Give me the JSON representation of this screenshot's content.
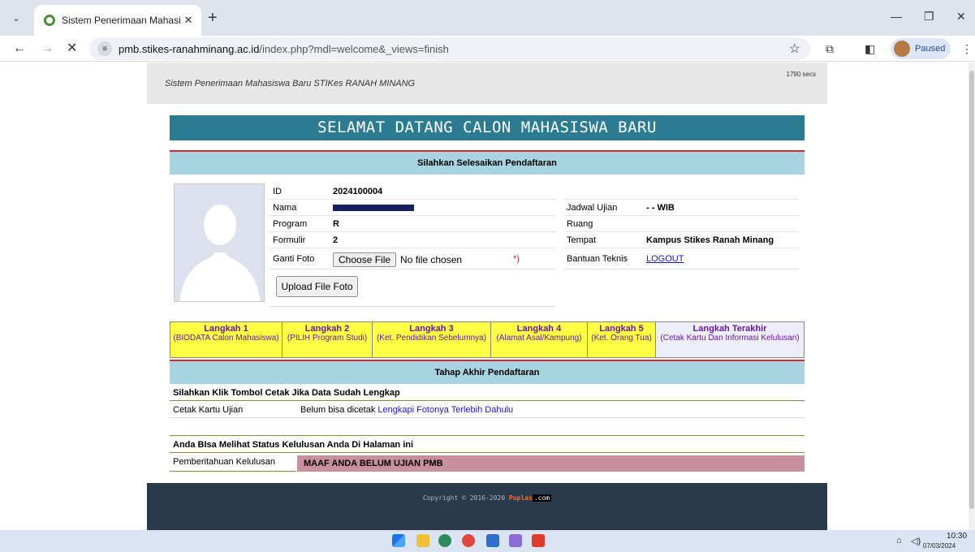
{
  "browser": {
    "tab_title": "Sistem Penerimaan Mahasiswa",
    "tab_close": "✕",
    "new_tab": "+",
    "url_host": "pmb.stikes-ranahminang.ac.id",
    "url_path": "/index.php?mdl=welcome&_views=finish",
    "profile_status": "Paused",
    "win_minimize": "—",
    "win_restore": "❐",
    "win_close": "✕",
    "nav_back": "←",
    "nav_forward": "→",
    "nav_stop": "✕",
    "bookmark_star": "☆"
  },
  "site": {
    "header_title": "Sistem Penerimaan Mahasiswa Baru STIKes RANAH MINANG",
    "secs": "1790 secs",
    "banner": "SELAMAT DATANG CALON MAHASISWA BARU",
    "section1_title": "Silahkan Selesaikan Pendaftaran"
  },
  "profile": {
    "id_label": "ID",
    "id_value": "2024100004",
    "nama_label": "Nama",
    "program_label": "Program",
    "program_value": "R",
    "formulir_label": "Formulir",
    "formulir_value": "2",
    "ganti_foto_label": "Ganti Foto",
    "choose_file_btn": "Choose File",
    "no_file": "No file chosen",
    "required_mark": "*)",
    "jadwal_label": "Jadwal Ujian",
    "jadwal_value": "- - WIB",
    "ruang_label": "Ruang",
    "tempat_label": "Tempat",
    "tempat_value": "Kampus Stikes Ranah Minang",
    "bantuan_label": "Bantuan Teknis",
    "logout": "LOGOUT",
    "upload_btn": "Upload File Foto"
  },
  "steps": [
    {
      "title": "Langkah 1",
      "desc": "(BIODATA Calon Mahasiswa)"
    },
    {
      "title": "Langkah 2",
      "desc": "(PILIH Program Studi)"
    },
    {
      "title": "Langkah 3",
      "desc": "(Ket. Pendidikan Sebelumnya)"
    },
    {
      "title": "Langkah 4",
      "desc": "(Alamat Asal/Kampung)"
    },
    {
      "title": "Langkah 5",
      "desc": "(Ket. Orang Tua)"
    },
    {
      "title": "Langkah Terakhir",
      "desc": "(Cetak Kartu Dan Informasi Kelulusan)"
    }
  ],
  "final": {
    "section_title": "Tahap Akhir Pendaftaran",
    "cetak_heading": "Silahkan Klik Tombol Cetak Jika Data Sudah Lengkap",
    "cetak_label": "Cetak Kartu Ujian",
    "cetak_status": "Belum bisa dicetak",
    "cetak_link": "Lengkapi Fotonya Terlebih Dahulu",
    "status_heading": "Anda BIsa Melihat Status Kelulusan Anda Di Halaman ini",
    "pemberitahuan_label": "Pemberitahuan Kelulusan",
    "pemberitahuan_value": "MAAF ANDA BELUM UJIAN PMB"
  },
  "footer": {
    "copyright": "Copyright © 2016-2020",
    "brand": "Puplas",
    "dotcom": ".com"
  },
  "taskbar": {
    "time": "10:30",
    "date": "07/03/2024"
  }
}
